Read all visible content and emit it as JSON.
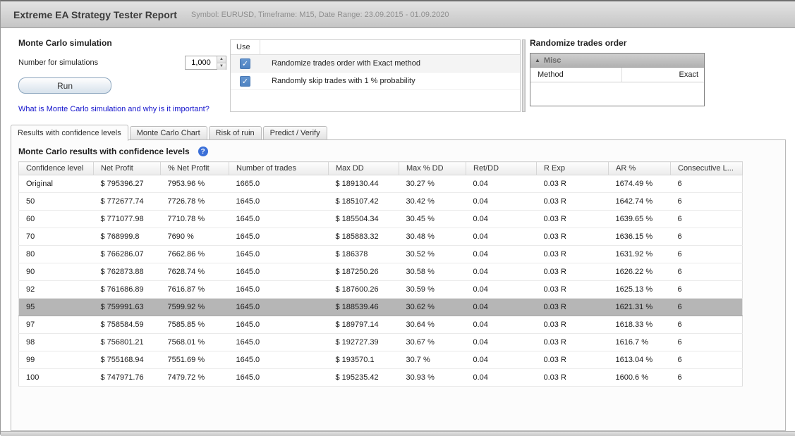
{
  "colors": {
    "link-blue": "#1414cc",
    "checkbox-blue": "#6495cf",
    "help-blue": "#3a6fd8",
    "selected-row": "#b6b6b6"
  },
  "header": {
    "title": "Extreme EA Strategy Tester Report",
    "subtitle": "Symbol: EURUSD, Timeframe: M15, Date Range: 23.09.2015 - 01.09.2020"
  },
  "simulation": {
    "title": "Monte Carlo simulation",
    "num_label": "Number for simulations",
    "num_value": "1,000",
    "run_label": "Run",
    "link": "What is Monte Carlo simulation and why is it important?"
  },
  "options": {
    "header": "Use",
    "items": [
      {
        "checked": true,
        "label": "Randomize trades order with Exact method"
      },
      {
        "checked": true,
        "label": "Randomly skip trades with 1 % probability"
      }
    ]
  },
  "randomize": {
    "title": "Randomize trades order",
    "group": "Misc",
    "rows": [
      {
        "key": "Method",
        "value": "Exact"
      }
    ]
  },
  "tabs": [
    {
      "label": "Results with confidence levels",
      "active": true
    },
    {
      "label": "Monte Carlo Chart",
      "active": false
    },
    {
      "label": "Risk of ruin",
      "active": false
    },
    {
      "label": "Predict / Verify",
      "active": false
    }
  ],
  "results": {
    "title": "Monte Carlo results with confidence levels",
    "help_icon": "?",
    "selected_row": 7,
    "columns": [
      "Confidence level",
      "Net Profit",
      "% Net Profit",
      "Number of trades",
      "Max DD",
      "Max % DD",
      "Ret/DD",
      "R Exp",
      "AR %",
      "Consecutive L..."
    ],
    "rows": [
      [
        "Original",
        "$ 795396.27",
        "7953.96 %",
        "1665.0",
        "$ 189130.44",
        "30.27 %",
        "0.04",
        "0.03 R",
        "1674.49 %",
        "6"
      ],
      [
        "50",
        "$ 772677.74",
        "7726.78 %",
        "1645.0",
        "$ 185107.42",
        "30.42 %",
        "0.04",
        "0.03 R",
        "1642.74 %",
        "6"
      ],
      [
        "60",
        "$ 771077.98",
        "7710.78 %",
        "1645.0",
        "$ 185504.34",
        "30.45 %",
        "0.04",
        "0.03 R",
        "1639.65 %",
        "6"
      ],
      [
        "70",
        "$ 768999.8",
        "7690 %",
        "1645.0",
        "$ 185883.32",
        "30.48 %",
        "0.04",
        "0.03 R",
        "1636.15 %",
        "6"
      ],
      [
        "80",
        "$ 766286.07",
        "7662.86 %",
        "1645.0",
        "$ 186378",
        "30.52 %",
        "0.04",
        "0.03 R",
        "1631.92 %",
        "6"
      ],
      [
        "90",
        "$ 762873.88",
        "7628.74 %",
        "1645.0",
        "$ 187250.26",
        "30.58 %",
        "0.04",
        "0.03 R",
        "1626.22 %",
        "6"
      ],
      [
        "92",
        "$ 761686.89",
        "7616.87 %",
        "1645.0",
        "$ 187600.26",
        "30.59 %",
        "0.04",
        "0.03 R",
        "1625.13 %",
        "6"
      ],
      [
        "95",
        "$ 759991.63",
        "7599.92 %",
        "1645.0",
        "$ 188539.46",
        "30.62 %",
        "0.04",
        "0.03 R",
        "1621.31 %",
        "6"
      ],
      [
        "97",
        "$ 758584.59",
        "7585.85 %",
        "1645.0",
        "$ 189797.14",
        "30.64 %",
        "0.04",
        "0.03 R",
        "1618.33 %",
        "6"
      ],
      [
        "98",
        "$ 756801.21",
        "7568.01 %",
        "1645.0",
        "$ 192727.39",
        "30.67 %",
        "0.04",
        "0.03 R",
        "1616.7 %",
        "6"
      ],
      [
        "99",
        "$ 755168.94",
        "7551.69 %",
        "1645.0",
        "$ 193570.1",
        "30.7 %",
        "0.04",
        "0.03 R",
        "1613.04 %",
        "6"
      ],
      [
        "100",
        "$ 747971.76",
        "7479.72 %",
        "1645.0",
        "$ 195235.42",
        "30.93 %",
        "0.04",
        "0.03 R",
        "1600.6 %",
        "6"
      ]
    ]
  }
}
